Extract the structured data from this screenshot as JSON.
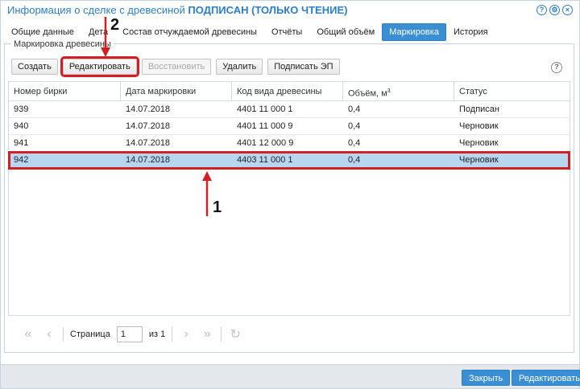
{
  "window": {
    "title_prefix": "Информация о сделке с древесиной",
    "title_status": "ПОДПИСАН",
    "title_suffix": "(ТОЛЬКО ЧТЕНИЕ)",
    "icons": [
      "help-icon",
      "settings-icon",
      "close-icon"
    ]
  },
  "tabs": [
    {
      "label": "Общие данные",
      "active": false
    },
    {
      "label": "Дета",
      "active": false
    },
    {
      "label": "Состав отчуждаемой древесины",
      "active": false
    },
    {
      "label": "Отчёты",
      "active": false
    },
    {
      "label": "Общий объём",
      "active": false
    },
    {
      "label": "Маркировка",
      "active": true
    },
    {
      "label": "История",
      "active": false
    }
  ],
  "panel": {
    "legend": "Маркировка древесины",
    "toolbar": {
      "create": "Создать",
      "edit": "Редактировать",
      "restore": "Восстановить",
      "delete": "Удалить",
      "sign": "Подписать ЭП"
    }
  },
  "grid": {
    "columns": [
      "Номер бирки",
      "Дата маркировки",
      "Код вида древесины",
      "Объём, м",
      "Статус"
    ],
    "volume_unit_sup": "3",
    "rows": [
      {
        "tag": "939",
        "date": "14.07.2018",
        "code": "4401 11 000 1",
        "volume": "0,4",
        "status": "Подписан",
        "selected": false
      },
      {
        "tag": "940",
        "date": "14.07.2018",
        "code": "4401 11 000 9",
        "volume": "0,4",
        "status": "Черновик",
        "selected": false
      },
      {
        "tag": "941",
        "date": "14.07.2018",
        "code": "4401 12 000 9",
        "volume": "0,4",
        "status": "Черновик",
        "selected": false
      },
      {
        "tag": "942",
        "date": "14.07.2018",
        "code": "4403 11 000 1",
        "volume": "0,4",
        "status": "Черновик",
        "selected": true
      }
    ]
  },
  "pager": {
    "page_label": "Страница",
    "page_value": "1",
    "of_label": "из 1"
  },
  "footer": {
    "close": "Закрыть",
    "edit": "Редактировать"
  },
  "annotations": {
    "marker_1": "1",
    "marker_2": "2",
    "color": "#d21f23"
  }
}
